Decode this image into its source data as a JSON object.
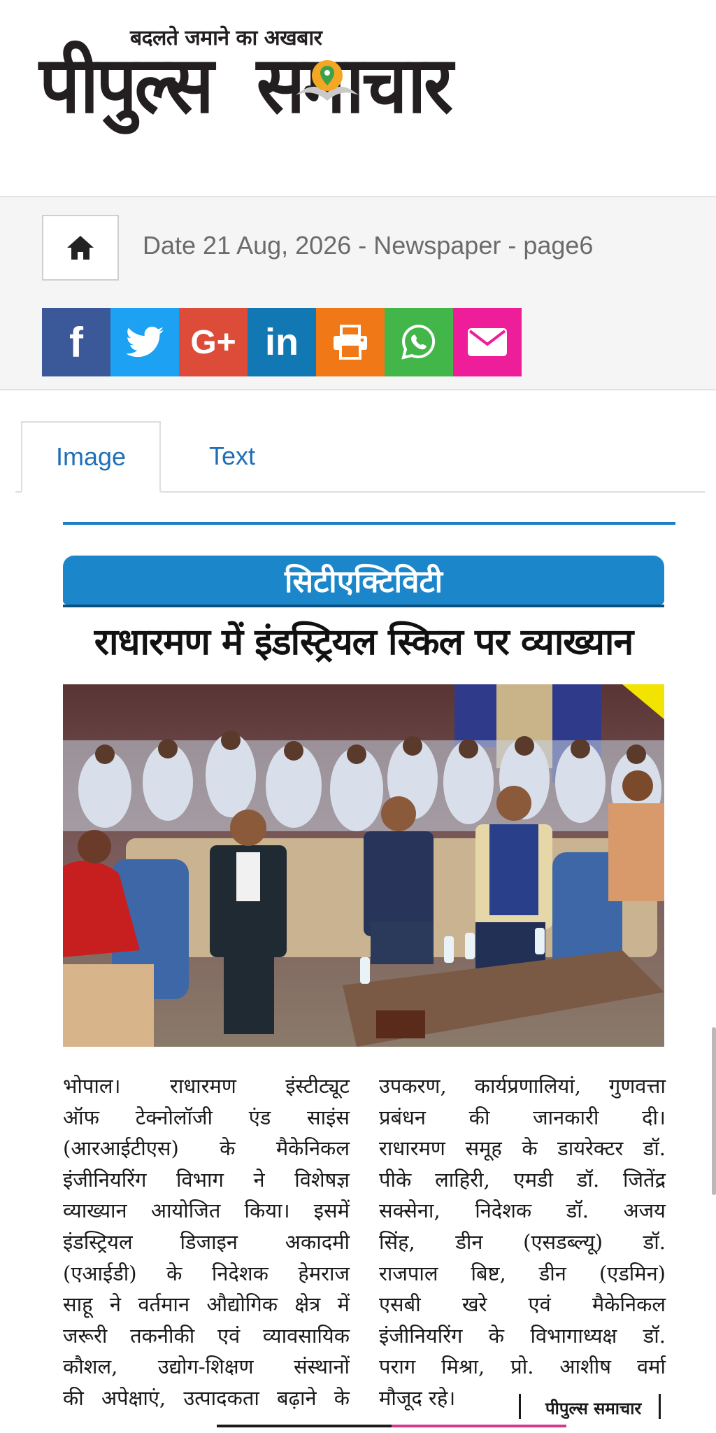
{
  "logo": {
    "tagline": "बदलते जमाने का अखबार",
    "name_left": "पीपुल्स",
    "name_right": "समाचार"
  },
  "toolbar": {
    "home_icon": "home-icon",
    "date_text": "Date 21 Aug, 2026 - Newspaper - page6"
  },
  "share": [
    {
      "name": "facebook",
      "glyph": "f",
      "color": "#3b5998"
    },
    {
      "name": "twitter",
      "glyph": "",
      "color": "#1da1f2"
    },
    {
      "name": "google-plus",
      "glyph": "G+",
      "color": "#dd4b39"
    },
    {
      "name": "linkedin",
      "glyph": "in",
      "color": "#1178b3"
    },
    {
      "name": "print",
      "glyph": "",
      "color": "#f07817"
    },
    {
      "name": "whatsapp",
      "glyph": "",
      "color": "#43b649"
    },
    {
      "name": "email",
      "glyph": "",
      "color": "#ee1e9a"
    }
  ],
  "tabs": [
    {
      "label": "Image",
      "active": true
    },
    {
      "label": "Text",
      "active": false
    }
  ],
  "clip": {
    "section": "सिटीएक्टिविटी",
    "headline": "राधारमण में इंडस्ट्रियल स्किल पर व्याख्यान",
    "left_lines": [
      "भोपाल। राधारमण इंस्टीट्यूट",
      "ऑफ टेक्नोलॉजी एंड साइंस",
      "(आरआईटीएस) के मैकेनिकल",
      "इंजीनियरिंग विभाग ने विशेषज्ञ",
      "व्याख्यान आयोजित किया। इसमें",
      "इंडस्ट्रियल डिजाइन अकादमी",
      "(एआईडी) के निदेशक हेमराज",
      "साहू ने वर्तमान औद्योगिक क्षेत्र में",
      "जरूरी तकनीकी एवं व्यावसायिक",
      "कौशल, उद्योग-शिक्षण संस्थानों",
      "की अपेक्षाएं, उत्पादकता बढ़ाने के"
    ],
    "right_lines": [
      "उपकरण, कार्यप्रणालियां, गुणवत्ता",
      "प्रबंधन की जानकारी दी।",
      "राधारमण समूह के डायरेक्टर डॉ.",
      "पीके लाहिरी, एमडी डॉ. जितेंद्र",
      "सक्सेना, निदेशक डॉ. अजय",
      "सिंह, डीन (एसडब्ल्यू) डॉ.",
      "राजपाल बिष्ट, डीन (एडमिन)",
      "एसबी खरे एवं मैकेनिकल",
      "इंजीनियरिंग के विभागाध्यक्ष डॉ.",
      "पराग मिश्रा, प्रो. आशीष वर्मा",
      "मौजूद रहे।"
    ],
    "byline": "पीपुल्स समाचार"
  }
}
